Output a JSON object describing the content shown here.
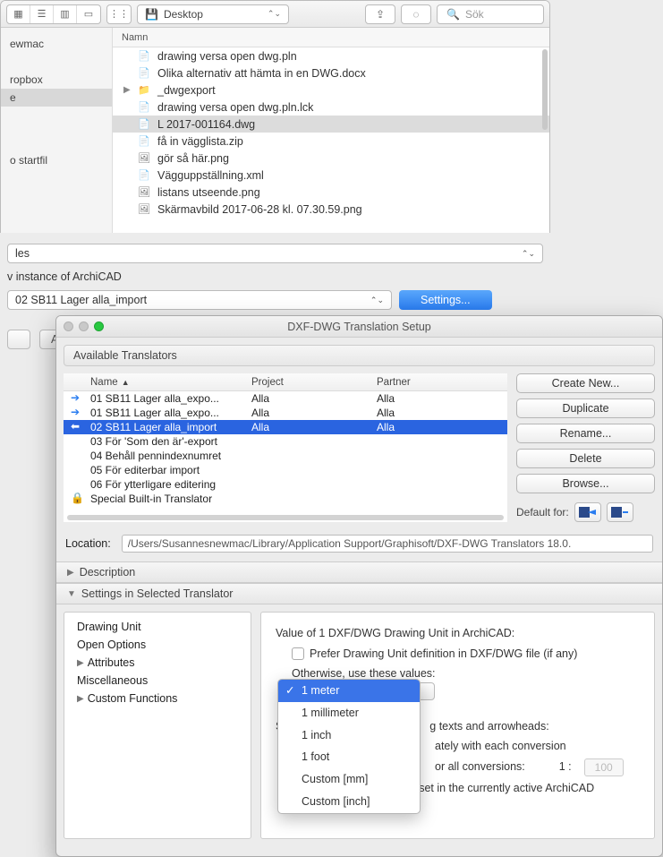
{
  "finder": {
    "path_label": "Desktop",
    "search_placeholder": "Sök",
    "column_header": "Namn",
    "sidebar": [
      "ewmac",
      "ropbox",
      "e",
      "o startfil"
    ],
    "sidebar_selected_index": 2,
    "files": [
      {
        "name": "drawing versa open dwg.pln",
        "selected": false
      },
      {
        "name": "Olika alternativ att hämta in en DWG.docx",
        "selected": false
      },
      {
        "name": "_dwgexport",
        "folder": true,
        "selected": false
      },
      {
        "name": "drawing versa open dwg.pln.lck",
        "selected": false
      },
      {
        "name": "L 2017-001164.dwg",
        "selected": true
      },
      {
        "name": "få in vägglista.zip",
        "selected": false
      },
      {
        "name": "gör så här.png",
        "selected": false
      },
      {
        "name": "Vägguppställning.xml",
        "selected": false
      },
      {
        "name": "listans utseende.png",
        "selected": false
      },
      {
        "name": "Skärmavbild 2017-06-28 kl. 07.30.59.png",
        "selected": false
      }
    ]
  },
  "middle": {
    "les_label": "les",
    "new_instance": "v instance of ArchiCAD",
    "translator_selected": "02 SB11 Lager alla_import",
    "settings_btn": "Settings...",
    "alter_btn": "Alte"
  },
  "setup": {
    "title": "DXF-DWG Translation Setup",
    "available": "Available Translators",
    "cols": {
      "name": "Name",
      "project": "Project",
      "partner": "Partner"
    },
    "rows": [
      {
        "name": "01 SB11 Lager alla_expo...",
        "project": "Alla",
        "partner": "Alla"
      },
      {
        "name": "01 SB11 Lager alla_expo...",
        "project": "Alla",
        "partner": "Alla"
      },
      {
        "name": "02 SB11 Lager alla_import",
        "project": "Alla",
        "partner": "Alla",
        "selected": true
      },
      {
        "name": "03 För 'Som den är'-export",
        "project": "",
        "partner": ""
      },
      {
        "name": "04 Behåll pennindexnumret",
        "project": "",
        "partner": ""
      },
      {
        "name": "05 För editerbar import",
        "project": "",
        "partner": ""
      },
      {
        "name": "06 För ytterligare editering",
        "project": "",
        "partner": ""
      },
      {
        "name": "Special Built-in Translator",
        "project": "",
        "partner": "",
        "locked": true
      }
    ],
    "buttons": {
      "create": "Create New...",
      "duplicate": "Duplicate",
      "rename": "Rename...",
      "delete": "Delete",
      "browse": "Browse..."
    },
    "default_for": "Default for:",
    "location_label": "Location:",
    "location_value": "/Users/Susannesnewmac/Library/Application Support/Graphisoft/DXF-DWG Translators 18.0.",
    "desc_hdr": "Description",
    "settings_hdr": "Settings in Selected Translator",
    "side_items": [
      "Drawing Unit",
      "Open Options",
      "Attributes",
      "Miscellaneous",
      "Custom Functions"
    ],
    "main": {
      "value_label": "Value of 1 DXF/DWG Drawing Unit in ArchiCAD:",
      "prefer_cb": "Prefer Drawing Unit definition in DXF/DWG file (if any)",
      "otherwise": "Otherwise, use these values:",
      "unit_opts": [
        "1 meter",
        "1 millimeter",
        "1 inch",
        "1 foot",
        "Custom [mm]",
        "Custom [inch]"
      ],
      "set_scale_frag": "Se",
      "set_scale_frag2": "g texts and arrowheads:",
      "r1": "ately with each conversion",
      "r2_a": "or all conversions:",
      "r2_ratio_label": "1 :",
      "r2_ratio_value": "100",
      "r3": "Always use the scale set in the currently active ArchiCAD window"
    }
  }
}
